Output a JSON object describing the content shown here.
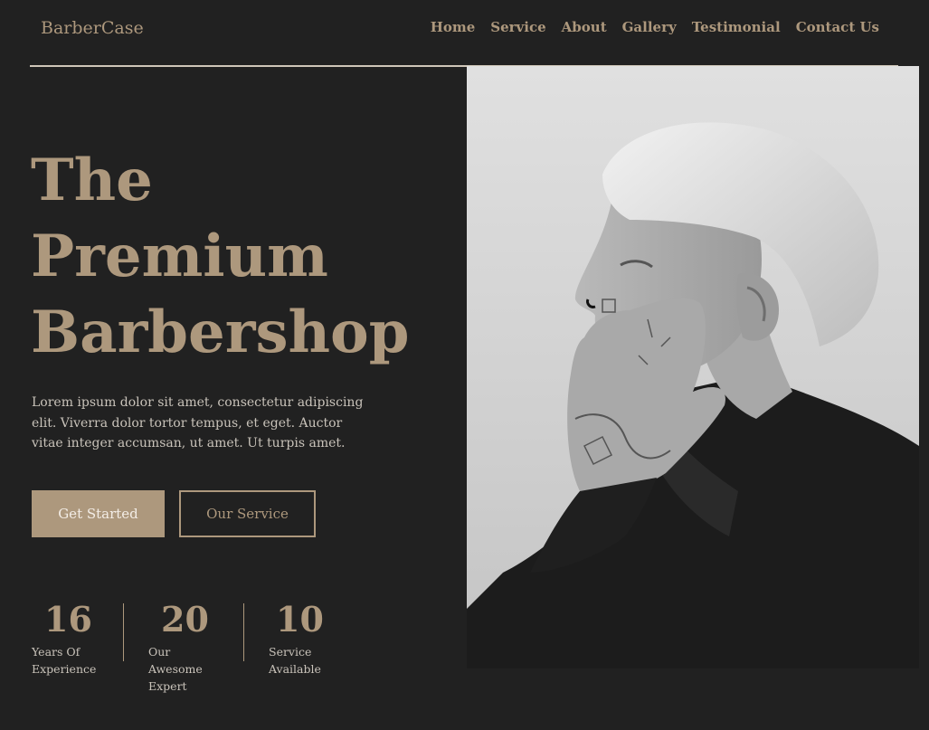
{
  "header": {
    "logo": "BarberCase",
    "nav": [
      "Home",
      "Service",
      "About",
      "Gallery",
      "Testimonial",
      "Contact Us"
    ]
  },
  "hero": {
    "title_lines": [
      "The",
      "Premium",
      "Barbershop"
    ],
    "description": "Lorem ipsum dolor sit amet, consectetur adipiscing elit. Viverra dolor tortor tempus, et eget. Auctor vitae integer accumsan, ut amet. Ut turpis amet.",
    "primary_button": "Get Started",
    "secondary_button": "Our Service"
  },
  "stats": [
    {
      "number": "16",
      "label_lines": [
        "Years Of",
        "Experience"
      ]
    },
    {
      "number": "20",
      "label_lines": [
        "Our",
        "Awesome",
        "Expert"
      ]
    },
    {
      "number": "10",
      "label_lines": [
        "Service",
        "Available"
      ]
    }
  ],
  "colors": {
    "background": "#212121",
    "accent": "#ad987d",
    "text_muted": "#c9c3ba"
  }
}
